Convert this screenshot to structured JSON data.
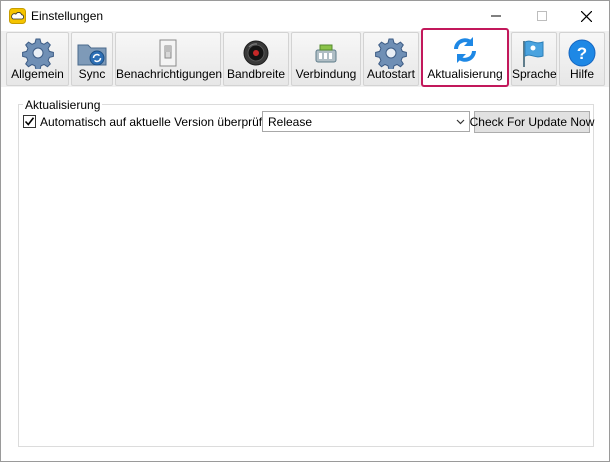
{
  "window": {
    "title": "Einstellungen",
    "accent_color": "#c2185b"
  },
  "toolbar": {
    "items": [
      {
        "label": "Allgemein",
        "icon": "gear-icon"
      },
      {
        "label": "Sync",
        "icon": "sync-folder-icon"
      },
      {
        "label": "Benachrichtigungen",
        "icon": "notification-switch-icon"
      },
      {
        "label": "Bandbreite",
        "icon": "bandwidth-gauge-icon"
      },
      {
        "label": "Verbindung",
        "icon": "network-connection-icon"
      },
      {
        "label": "Autostart",
        "icon": "gear-icon"
      },
      {
        "label": "Aktualisierung",
        "icon": "refresh-icon",
        "active": true
      },
      {
        "label": "Sprache",
        "icon": "flag-icon"
      },
      {
        "label": "Hilfe",
        "icon": "help-icon"
      }
    ]
  },
  "update": {
    "group_title": "Aktualisierung",
    "auto_check_label": "Automatisch auf aktuelle Version überprüfen in",
    "auto_check_checked": true,
    "channel_selected": "Release",
    "check_button_label": "Check For Update Now"
  }
}
